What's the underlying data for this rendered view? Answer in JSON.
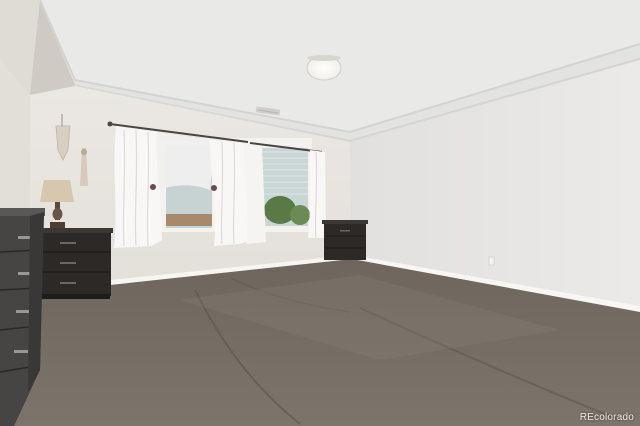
{
  "watermark": {
    "text": "REcolorado"
  },
  "colors": {
    "ceiling": "#e4e4e2",
    "tray_ceiling": "#ebebe9",
    "back_wall": "#e9e6e1",
    "right_wall": "#e6e5e3",
    "left_wall": "#e1ddd7",
    "baseboard": "#f6f5f2",
    "carpet": "#716960",
    "carpet_light": "#8a8279",
    "furniture_dark": "#2b2826",
    "dresser_gray": "#4a4846",
    "curtain": "#f7f6f4",
    "window_glass": "#c8d6d6"
  }
}
